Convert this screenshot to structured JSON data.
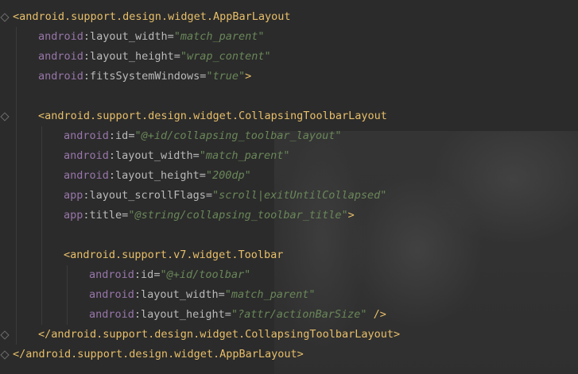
{
  "editor": {
    "lines": [
      {
        "indent": 0,
        "parts": [
          {
            "t": "tag",
            "v": "<android.support.design.widget.AppBarLayout"
          }
        ]
      },
      {
        "indent": 1,
        "parts": [
          {
            "t": "attr-ns",
            "v": "android"
          },
          {
            "t": "punct",
            "v": ":"
          },
          {
            "t": "attr-name",
            "v": "layout_width"
          },
          {
            "t": "punct",
            "v": "="
          },
          {
            "t": "attr-val",
            "v": "\"match_parent\""
          }
        ]
      },
      {
        "indent": 1,
        "parts": [
          {
            "t": "attr-ns",
            "v": "android"
          },
          {
            "t": "punct",
            "v": ":"
          },
          {
            "t": "attr-name",
            "v": "layout_height"
          },
          {
            "t": "punct",
            "v": "="
          },
          {
            "t": "attr-val",
            "v": "\"wrap_content\""
          }
        ]
      },
      {
        "indent": 1,
        "parts": [
          {
            "t": "attr-ns",
            "v": "android"
          },
          {
            "t": "punct",
            "v": ":"
          },
          {
            "t": "attr-name",
            "v": "fitsSystemWindows"
          },
          {
            "t": "punct",
            "v": "="
          },
          {
            "t": "attr-val",
            "v": "\"true\""
          },
          {
            "t": "bracket",
            "v": ">"
          }
        ]
      },
      {
        "indent": 0,
        "parts": []
      },
      {
        "indent": 1,
        "parts": [
          {
            "t": "tag",
            "v": "<android.support.design.widget.CollapsingToolbarLayout"
          }
        ]
      },
      {
        "indent": 2,
        "parts": [
          {
            "t": "attr-ns",
            "v": "android"
          },
          {
            "t": "punct",
            "v": ":"
          },
          {
            "t": "attr-name",
            "v": "id"
          },
          {
            "t": "punct",
            "v": "="
          },
          {
            "t": "attr-val",
            "v": "\"@+id/collapsing_toolbar_layout\""
          }
        ]
      },
      {
        "indent": 2,
        "parts": [
          {
            "t": "attr-ns",
            "v": "android"
          },
          {
            "t": "punct",
            "v": ":"
          },
          {
            "t": "attr-name",
            "v": "layout_width"
          },
          {
            "t": "punct",
            "v": "="
          },
          {
            "t": "attr-val",
            "v": "\"match_parent\""
          }
        ]
      },
      {
        "indent": 2,
        "parts": [
          {
            "t": "attr-ns",
            "v": "android"
          },
          {
            "t": "punct",
            "v": ":"
          },
          {
            "t": "attr-name",
            "v": "layout_height"
          },
          {
            "t": "punct",
            "v": "="
          },
          {
            "t": "attr-val",
            "v": "\"200dp\""
          }
        ]
      },
      {
        "indent": 2,
        "parts": [
          {
            "t": "attr-ns",
            "v": "app"
          },
          {
            "t": "punct",
            "v": ":"
          },
          {
            "t": "attr-name",
            "v": "layout_scrollFlags"
          },
          {
            "t": "punct",
            "v": "="
          },
          {
            "t": "attr-val",
            "v": "\"scroll|exitUntilCollapsed\""
          }
        ]
      },
      {
        "indent": 2,
        "parts": [
          {
            "t": "attr-ns",
            "v": "app"
          },
          {
            "t": "punct",
            "v": ":"
          },
          {
            "t": "attr-name",
            "v": "title"
          },
          {
            "t": "punct",
            "v": "="
          },
          {
            "t": "attr-val",
            "v": "\"@string/collapsing_toolbar_title\""
          },
          {
            "t": "bracket",
            "v": ">"
          }
        ]
      },
      {
        "indent": 0,
        "parts": []
      },
      {
        "indent": 2,
        "parts": [
          {
            "t": "tag",
            "v": "<android.support.v7.widget.Toolbar"
          }
        ]
      },
      {
        "indent": 3,
        "parts": [
          {
            "t": "attr-ns",
            "v": "android"
          },
          {
            "t": "punct",
            "v": ":"
          },
          {
            "t": "attr-name",
            "v": "id"
          },
          {
            "t": "punct",
            "v": "="
          },
          {
            "t": "attr-val",
            "v": "\"@+id/toolbar\""
          }
        ]
      },
      {
        "indent": 3,
        "parts": [
          {
            "t": "attr-ns",
            "v": "android"
          },
          {
            "t": "punct",
            "v": ":"
          },
          {
            "t": "attr-name",
            "v": "layout_width"
          },
          {
            "t": "punct",
            "v": "="
          },
          {
            "t": "attr-val",
            "v": "\"match_parent\""
          }
        ]
      },
      {
        "indent": 3,
        "parts": [
          {
            "t": "attr-ns",
            "v": "android"
          },
          {
            "t": "punct",
            "v": ":"
          },
          {
            "t": "attr-name",
            "v": "layout_height"
          },
          {
            "t": "punct",
            "v": "="
          },
          {
            "t": "attr-val",
            "v": "\"?attr/actionBarSize\""
          },
          {
            "t": "bracket",
            "v": " />"
          }
        ]
      },
      {
        "indent": 1,
        "parts": [
          {
            "t": "tag",
            "v": "</android.support.design.widget.CollapsingToolbarLayout>"
          }
        ]
      },
      {
        "indent": 0,
        "parts": [
          {
            "t": "tag",
            "v": "</android.support.design.widget.AppBarLayout>"
          }
        ]
      }
    ]
  },
  "colors": {
    "background": "#2b2b2b",
    "tag": "#e8bf6a",
    "namespace": "#9876aa",
    "attribute": "#bababa",
    "value": "#6a8759"
  }
}
